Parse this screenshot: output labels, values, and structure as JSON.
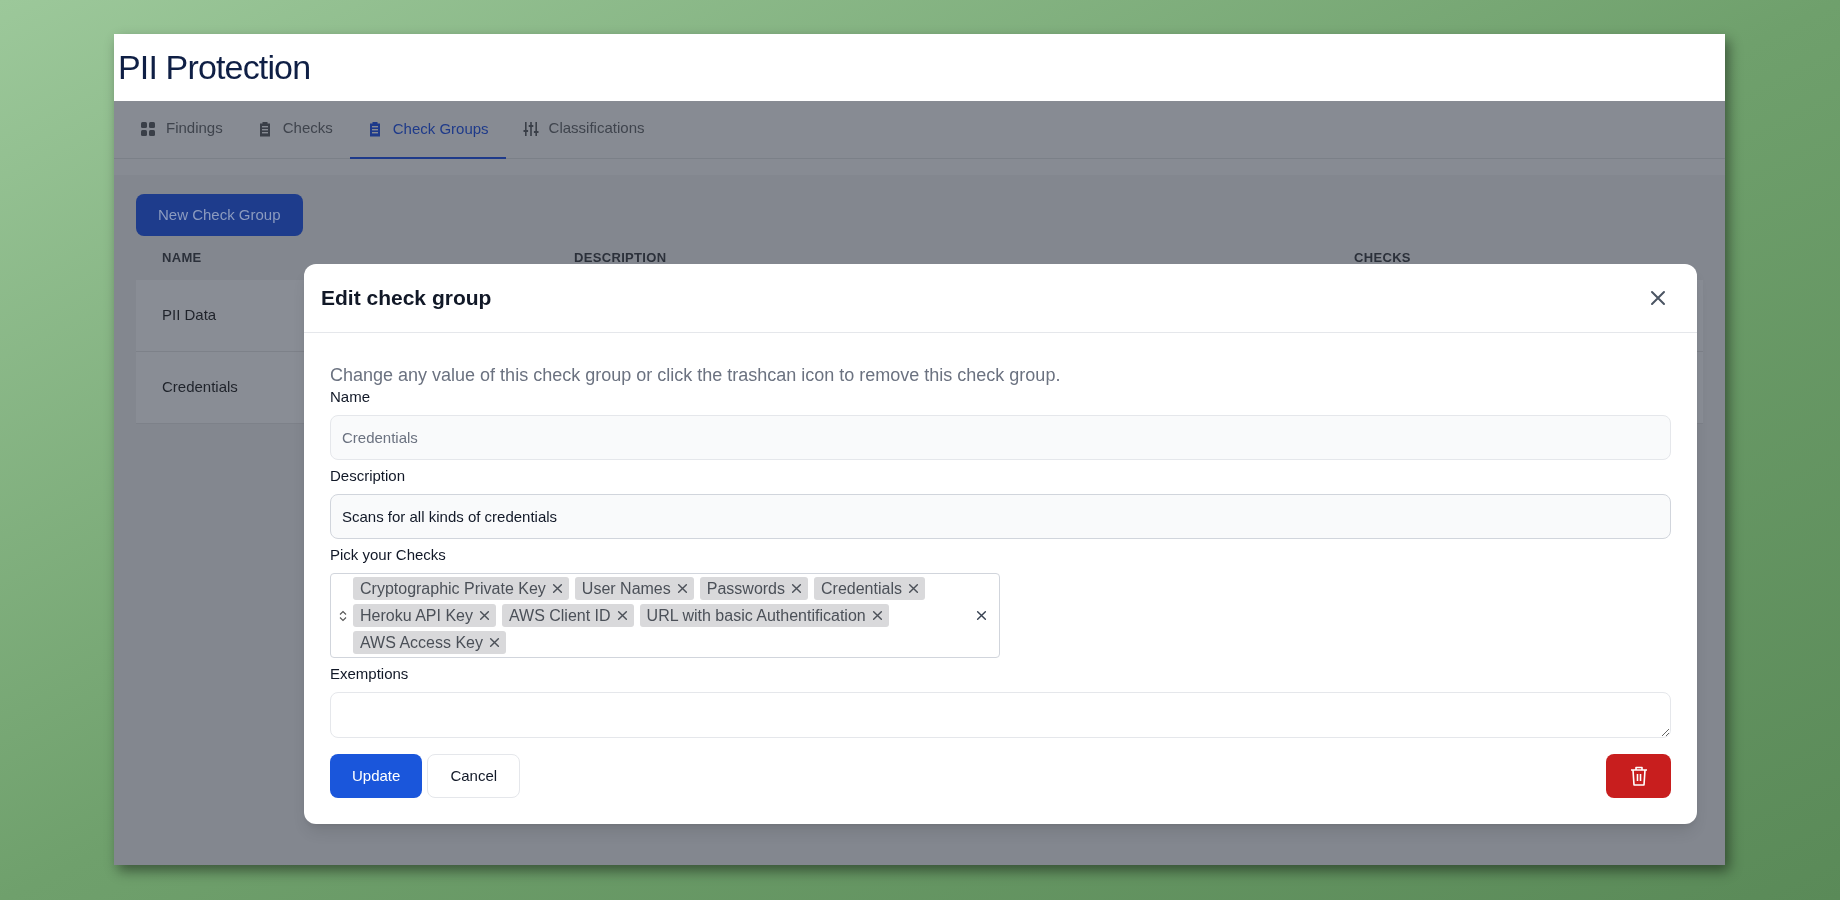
{
  "page": {
    "title": "PII Protection"
  },
  "tabs": [
    {
      "label": "Findings",
      "selected": false
    },
    {
      "label": "Checks",
      "selected": false
    },
    {
      "label": "Check Groups",
      "selected": true
    },
    {
      "label": "Classifications",
      "selected": false
    }
  ],
  "new_button": "New Check Group",
  "table": {
    "columns": [
      "NAME",
      "DESCRIPTION",
      "CHECKS"
    ],
    "rows": [
      {
        "name": "PII Data"
      },
      {
        "name": "Credentials"
      }
    ]
  },
  "modal": {
    "title": "Edit check group",
    "intro": "Change any value of this check group or click the trashcan icon to remove this check group.",
    "fields": [
      {
        "kind": "input",
        "label": "Name",
        "value": "Credentials",
        "disabled": true
      },
      {
        "kind": "input",
        "label": "Description",
        "value": "Scans for all kinds of credentials",
        "disabled": false
      },
      {
        "kind": "multiselect",
        "label": "Pick your Checks",
        "tags": [
          "Cryptographic Private Key",
          "User Names",
          "Passwords",
          "Credentials",
          "Heroku API Key",
          "AWS Client ID",
          "URL with basic Authentification",
          "AWS Access Key"
        ]
      },
      {
        "kind": "textarea",
        "label": "Exemptions"
      }
    ],
    "buttons": [
      "Update",
      "Cancel"
    ]
  }
}
